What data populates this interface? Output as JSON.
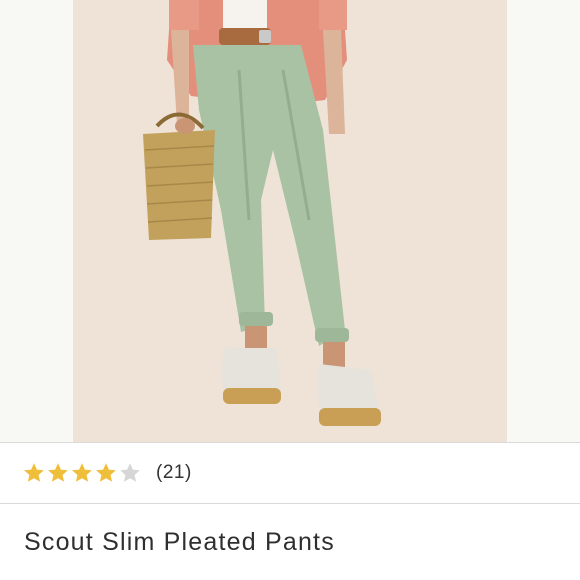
{
  "product": {
    "image_icon": "product-photo",
    "title": "Scout Slim Pleated Pants",
    "rating": {
      "stars_filled": 4,
      "stars_total": 5,
      "review_count_label": "(21)"
    }
  },
  "colors": {
    "star_filled": "#efbe3a",
    "star_empty": "#d6d6d6",
    "pants": "#a9c2a4",
    "blazer": "#e48f7c",
    "background": "#eee3d6"
  }
}
